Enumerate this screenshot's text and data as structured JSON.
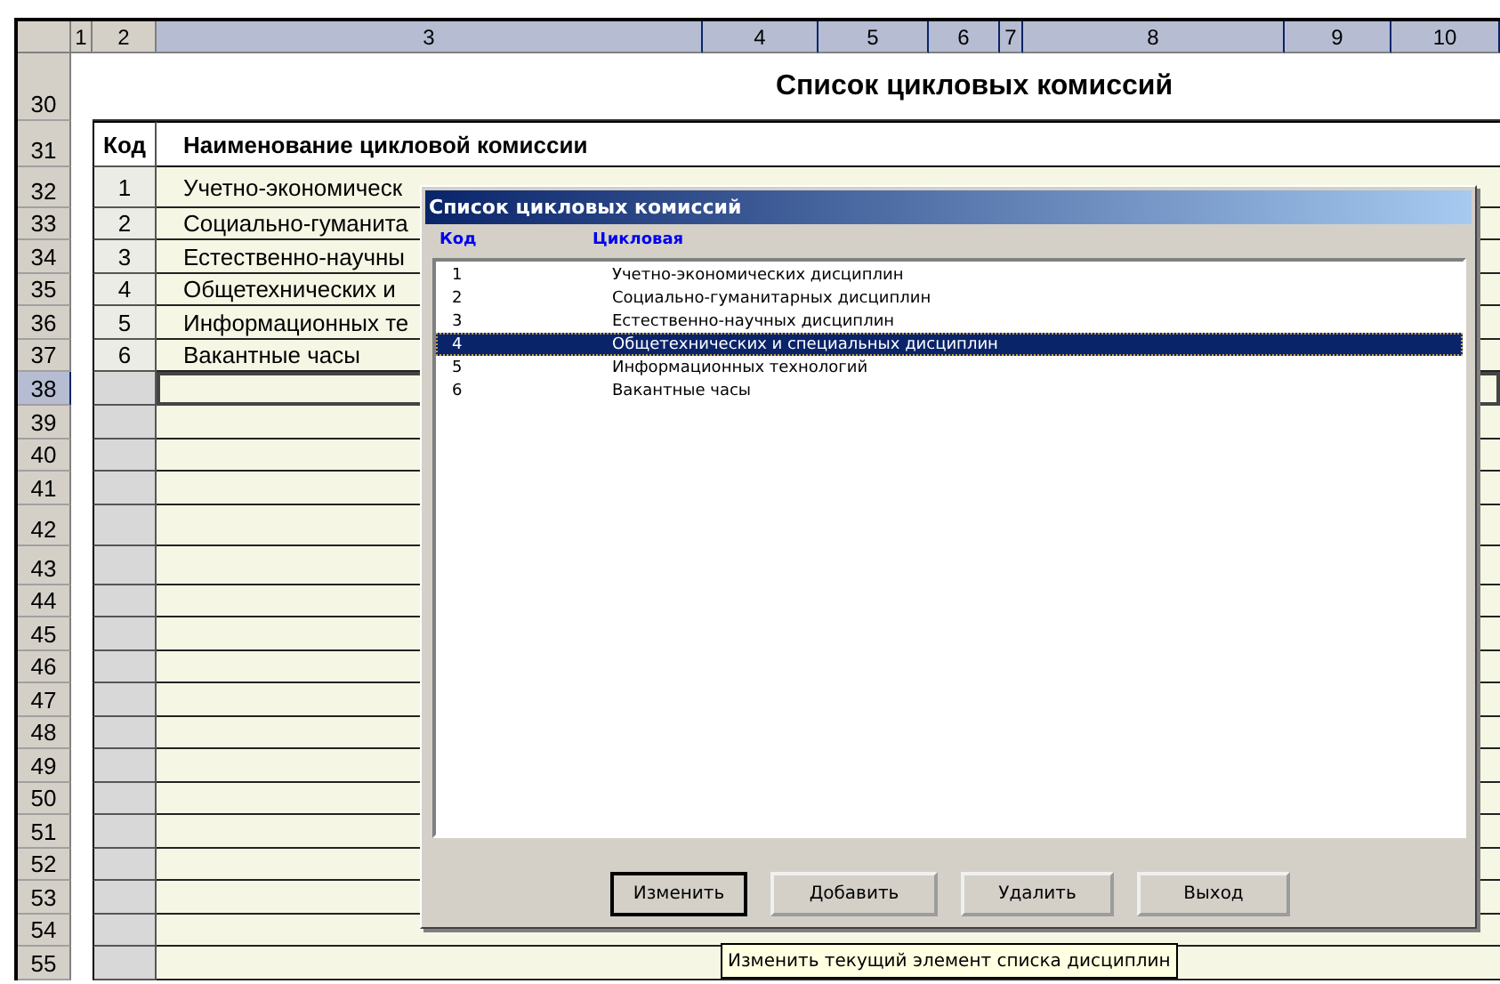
{
  "sheet": {
    "columns": [
      {
        "label": "1",
        "selected": false
      },
      {
        "label": "2",
        "selected": false
      },
      {
        "label": "3",
        "selected": true
      },
      {
        "label": "4",
        "selected": true
      },
      {
        "label": "5",
        "selected": true
      },
      {
        "label": "6",
        "selected": true
      },
      {
        "label": "7",
        "selected": true
      },
      {
        "label": "8",
        "selected": true
      },
      {
        "label": "9",
        "selected": true
      },
      {
        "label": "10",
        "selected": true
      }
    ],
    "rows": [
      {
        "number": "30",
        "kind": "title",
        "text": "Список цикловых комиссий",
        "selected": false
      },
      {
        "number": "31",
        "kind": "header",
        "code": "Код",
        "name": "Наименование цикловой комиссии",
        "selected": false
      },
      {
        "number": "32",
        "kind": "data",
        "code": "1",
        "name": "Учетно-экономическ",
        "selected": false
      },
      {
        "number": "33",
        "kind": "data",
        "code": "2",
        "name": "Социально-гуманита",
        "selected": false
      },
      {
        "number": "34",
        "kind": "data",
        "code": "3",
        "name": "Естественно-научны",
        "selected": false
      },
      {
        "number": "35",
        "kind": "data",
        "code": "4",
        "name": "Общетехнических и",
        "selected": false
      },
      {
        "number": "36",
        "kind": "data",
        "code": "5",
        "name": "Информационных те",
        "selected": false
      },
      {
        "number": "37",
        "kind": "data",
        "code": "6",
        "name": "Вакантные часы",
        "selected": false
      },
      {
        "number": "38",
        "kind": "empty",
        "selected": true
      },
      {
        "number": "39",
        "kind": "empty",
        "selected": false
      },
      {
        "number": "40",
        "kind": "empty",
        "selected": false
      },
      {
        "number": "41",
        "kind": "empty",
        "selected": false
      },
      {
        "number": "42",
        "kind": "empty",
        "selected": false
      },
      {
        "number": "43",
        "kind": "empty",
        "selected": false
      },
      {
        "number": "44",
        "kind": "empty",
        "selected": false
      },
      {
        "number": "45",
        "kind": "empty",
        "selected": false
      },
      {
        "number": "46",
        "kind": "empty",
        "selected": false
      },
      {
        "number": "47",
        "kind": "empty",
        "selected": false
      },
      {
        "number": "48",
        "kind": "empty",
        "selected": false
      },
      {
        "number": "49",
        "kind": "empty",
        "selected": false
      },
      {
        "number": "50",
        "kind": "empty",
        "selected": false
      },
      {
        "number": "51",
        "kind": "empty",
        "selected": false
      },
      {
        "number": "52",
        "kind": "empty",
        "selected": false
      },
      {
        "number": "53",
        "kind": "empty",
        "selected": false
      },
      {
        "number": "54",
        "kind": "empty",
        "selected": false
      },
      {
        "number": "55",
        "kind": "empty",
        "selected": false
      }
    ]
  },
  "dialog": {
    "title": "Список цикловых комиссий",
    "columns": [
      "Код",
      "Цикловая"
    ],
    "items": [
      {
        "code": "1",
        "name": "Учетно-экономических дисциплин",
        "selected": false
      },
      {
        "code": "2",
        "name": "Социально-гуманитарных дисциплин",
        "selected": false
      },
      {
        "code": "3",
        "name": "Естественно-научных дисциплин",
        "selected": false
      },
      {
        "code": "4",
        "name": "Общетехнических и специальных дисциплин",
        "selected": true
      },
      {
        "code": "5",
        "name": "Информационных технологий",
        "selected": false
      },
      {
        "code": "6",
        "name": "Вакантные часы",
        "selected": false
      }
    ],
    "buttons": [
      {
        "label": "Изменить",
        "default": true
      },
      {
        "label": "Добавить",
        "default": false
      },
      {
        "label": "Удалить",
        "default": false
      },
      {
        "label": "Выход",
        "default": false
      }
    ]
  },
  "tooltip": "Изменить текущий элемент списка дисциплин"
}
